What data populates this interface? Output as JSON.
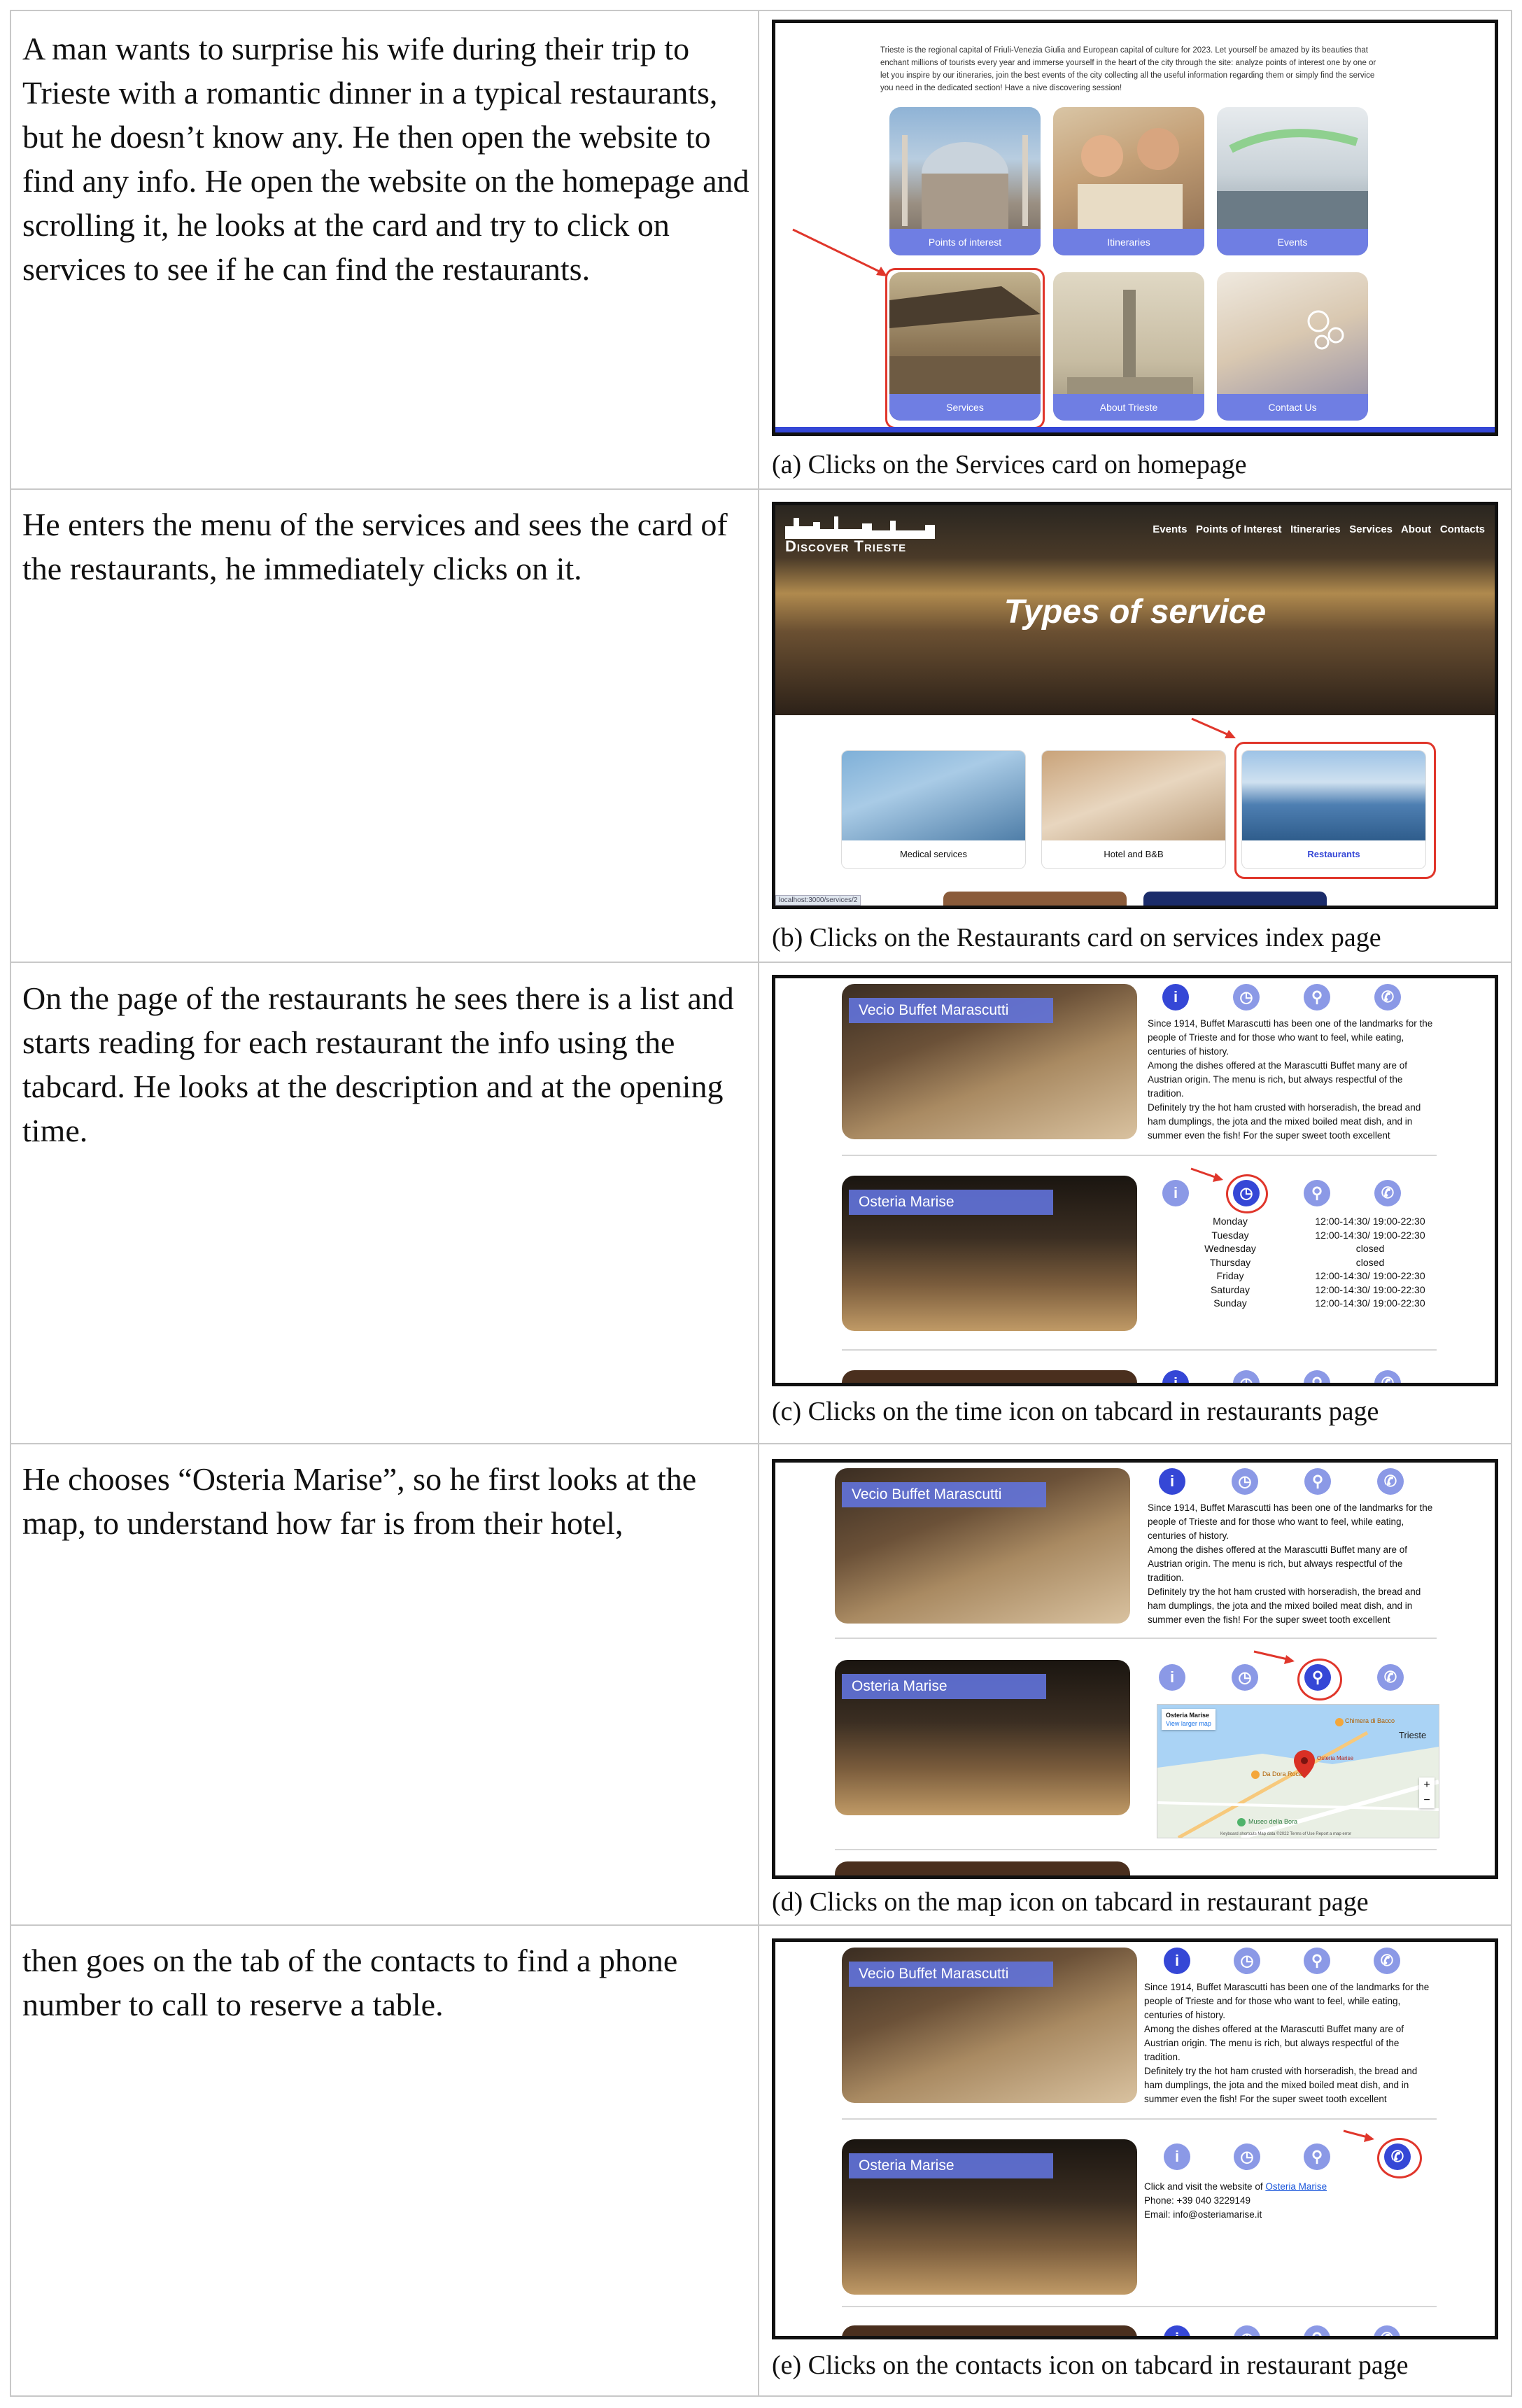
{
  "rows": [
    {
      "story": "A man wants to surprise his wife during their trip to Trieste with a romantic dinner in a typical restaurants, but he doesn’t know any. He then open the website to find any info. He open the website on the homepage and scrolling it, he looks at the card and try to click on services to see if he can find the restaurants.",
      "caption": "(a) Clicks on the Services card on homepage"
    },
    {
      "story": "He enters the menu of the services and sees the card of the restaurants, he immediately clicks on it.",
      "caption": "(b) Clicks on the Restaurants card on services index page"
    },
    {
      "story": "On the page of the restaurants he sees there is a list and starts reading for each restaurant the info using the tabcard. He looks at the description and at the opening time.",
      "caption": "(c) Clicks on the time icon on tabcard in restaurants page"
    },
    {
      "story": "He chooses “Osteria Marise”, so he first looks at the map, to understand how far is from their hotel,",
      "caption": "(d) Clicks on the map icon on tabcard in restaurant page"
    },
    {
      "story": "then goes on the tab of the contacts to find a phone number to call to reserve a table.",
      "caption": "(e) Clicks on the contacts icon on tabcard in restaurant page"
    }
  ],
  "home": {
    "intro": "Trieste is the regional capital of Friuli-Venezia Giulia and European capital of culture for 2023. Let yourself be amazed by its beauties that enchant millions of tourists every year and immerse yourself in the heart of the city through the site: analyze points of interest one by one or let you inspire by our itineraries, join the best events of the city collecting all the useful information regarding them or simply find the service you need in the dedicated section! Have a nive discovering session!",
    "cards": [
      "Points of interest",
      "Itineraries",
      "Events",
      "Services",
      "About Trieste",
      "Contact Us"
    ]
  },
  "services_page": {
    "logo": "Discover Trieste",
    "nav": [
      "Events",
      "Points of Interest",
      "Itineraries",
      "Services",
      "About",
      "Contacts"
    ],
    "hero_title": "Types of service",
    "cards": [
      "Medical services",
      "Hotel and B&B",
      "Restaurants"
    ],
    "status_url": "localhost:3000/services/2"
  },
  "restaurants": {
    "r1_name": "Vecio Buffet Marascutti",
    "r2_name": "Osteria Marise",
    "r1_description": [
      "Since 1914, Buffet Marascutti has been one of the landmarks for the",
      "people of Trieste and for those who want to feel, while eating,",
      "centuries of history.",
      "Among the dishes offered at the Marascutti Buffet many are of",
      "Austrian origin. The menu is rich, but always respectful of the",
      "tradition.",
      "Definitely try the hot ham crusted with horseradish, the bread and",
      "ham dumplings, the jota and the mixed boiled meat dish, and in",
      "summer even the fish! For the super sweet tooth excellent"
    ],
    "hours": [
      {
        "day": "Monday",
        "time": "12:00-14:30/ 19:00-22:30"
      },
      {
        "day": "Tuesday",
        "time": "12:00-14:30/ 19:00-22:30"
      },
      {
        "day": "Wednesday",
        "time": "closed"
      },
      {
        "day": "Thursday",
        "time": "closed"
      },
      {
        "day": "Friday",
        "time": "12:00-14:30/ 19:00-22:30"
      },
      {
        "day": "Saturday",
        "time": "12:00-14:30/ 19:00-22:30"
      },
      {
        "day": "Sunday",
        "time": "12:00-14:30/ 19:00-22:30"
      }
    ],
    "map": {
      "place": "Osteria Marise",
      "view_link": "View larger map",
      "city": "Trieste",
      "poi1": "Chimera di Bacco",
      "poi2": "Da Dora Roca",
      "poi3": "Museo della Bora",
      "footer": "Keyboard shortcuts   Map data ©2022   Terms of Use   Report a map error"
    },
    "contacts": {
      "line1_prefix": "Click and visit the website of ",
      "line1_link": "Osteria Marise",
      "phone": "Phone: +39 040 3229149",
      "email": "Email: info@osteriamarise.it"
    }
  },
  "colors": {
    "accent": "#6f7ee3",
    "icon_active": "#3547d6",
    "icon_inactive": "#8b99e6",
    "highlight": "#e0362b"
  }
}
